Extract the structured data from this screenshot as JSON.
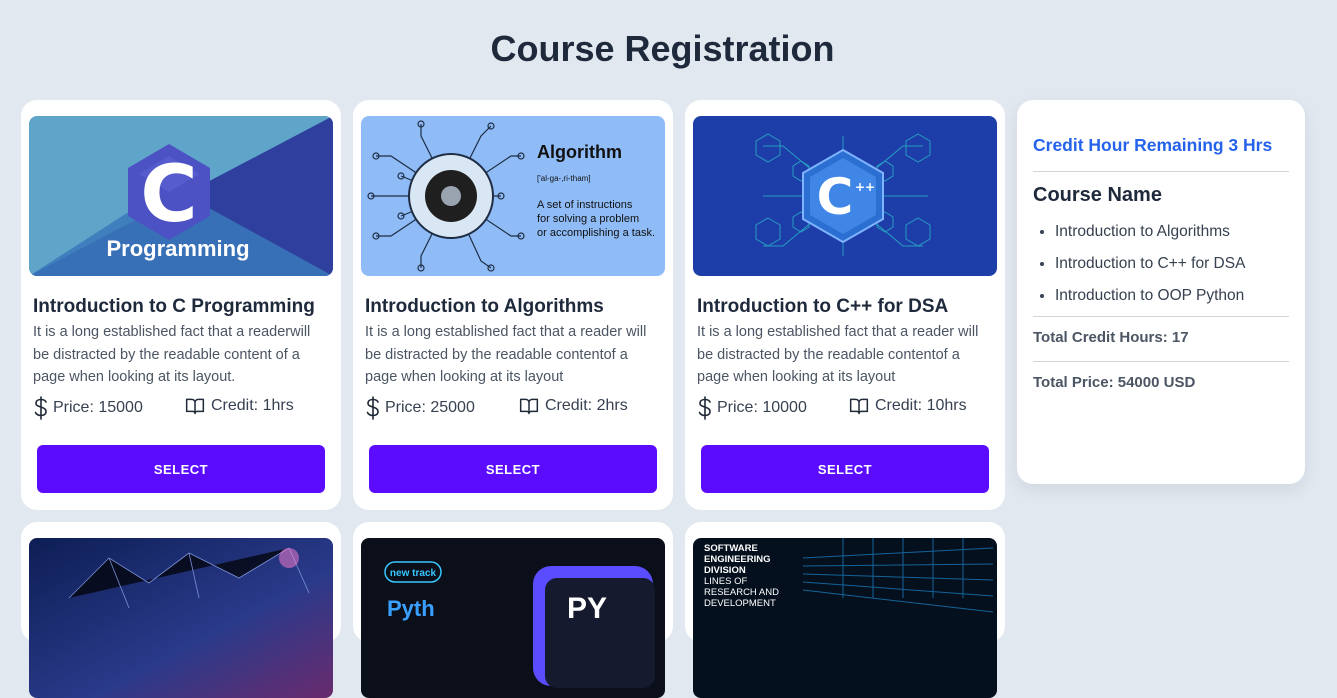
{
  "page": {
    "title": "Course Registration"
  },
  "courses": [
    {
      "title": "Introduction to C Programming",
      "description": "It is a long established fact that a readerwill be distracted by the readable content of a page when looking at its layout.",
      "price": "Price: 15000",
      "credit": "Credit: 1hrs",
      "button": "SELECT",
      "image": {
        "caption": "Programming",
        "letter": "C"
      }
    },
    {
      "title": "Introduction to Algorithms",
      "description": "It is a long established fact that a reader will be distracted by the readable contentof a page when looking at its layout",
      "price": "Price: 25000",
      "credit": "Credit: 2hrs",
      "button": "SELECT",
      "image": {
        "heading": "Algorithm",
        "phonetic": "['al-ga-,ri-tham]",
        "text_lines": [
          "A set of instructions",
          "for solving a problem",
          "or accomplishing a task."
        ]
      }
    },
    {
      "title": "Introduction to C++ for DSA",
      "description": "It is a long established fact that a reader will be distracted by the readable contentof a page when looking at its layout",
      "price": "Price: 10000",
      "credit": "Credit: 10hrs",
      "button": "SELECT",
      "image": {
        "letter": "C",
        "suffix": "++"
      }
    }
  ],
  "row2_images": [
    {
      "text": ""
    },
    {
      "badge": "new track",
      "partial_left": "Pyth",
      "partial_right": "PY"
    },
    {
      "lines": [
        "SOFTWARE",
        "ENGINEERING",
        "DIVISION",
        "LINES OF",
        "RESEARCH AND",
        "DEVELOPMENT"
      ]
    }
  ],
  "sidebar": {
    "remaining": "Credit Hour Remaining 3 Hrs",
    "heading": "Course Name",
    "selected": [
      "Introduction to Algorithms",
      "Introduction to C++ for DSA",
      "Introduction to OOP Python"
    ],
    "total_credit": "Total Credit Hours: 17",
    "total_price": "Total Price: 54000 USD"
  },
  "colors": {
    "accent": "#5b0cff",
    "link": "#2563eb",
    "background": "#e2e8f0"
  },
  "icons": {
    "price": "dollar-icon",
    "credit": "book-open-icon"
  }
}
